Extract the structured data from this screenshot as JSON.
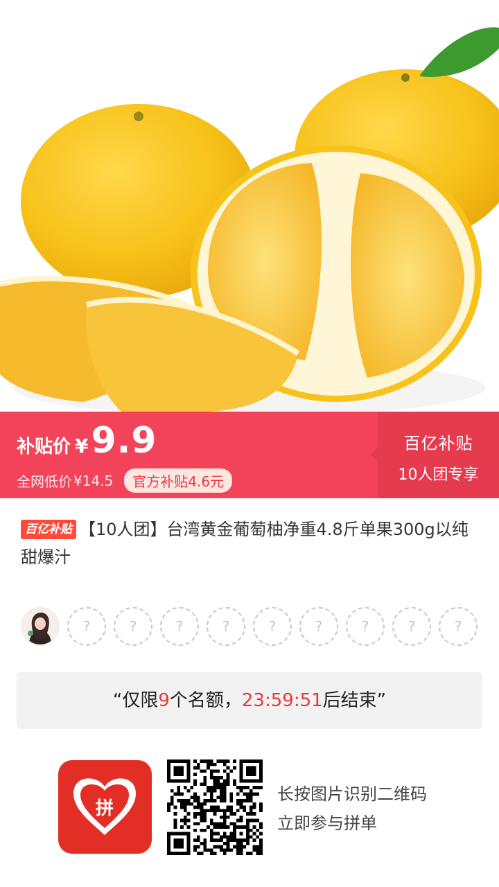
{
  "product_image": {
    "alt": "台湾黄金葡萄柚"
  },
  "price_bar": {
    "label": "补贴价",
    "currency": "¥",
    "price": "9.9",
    "original_label": "全网低价",
    "original_price": "¥14.5",
    "subsidy": "官方补贴4.6元",
    "right_title": "百亿补贴",
    "right_subtitle": "10人团专享"
  },
  "product": {
    "badge": "百亿补贴",
    "title": "【10人团】台湾黄金葡萄柚净重4.8斤单果300g以纯甜爆汁"
  },
  "group": {
    "empty_slots": [
      "?",
      "?",
      "?",
      "?",
      "?",
      "?",
      "?",
      "?",
      "?"
    ]
  },
  "notice": {
    "prefix": "“仅限",
    "count": "9",
    "middle": "个名额，",
    "timer": "23:59:51",
    "suffix": "后结束”"
  },
  "footer": {
    "logo_text": "拼",
    "line1": "长按图片识别二维码",
    "line2": "立即参与拼单"
  },
  "colors": {
    "brand_red": "#f2435a",
    "brand_red_dark": "#e63a4f",
    "logo_red": "#e22e25",
    "timer_red": "#e23a3a"
  }
}
